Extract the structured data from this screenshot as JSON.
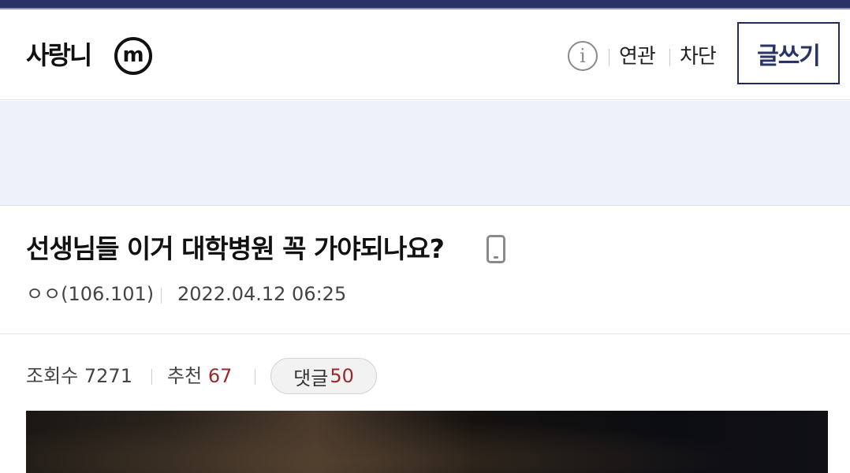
{
  "header": {
    "gallery_name": "사랑니",
    "minor_badge": "m",
    "info_icon": "info-icon",
    "links": [
      "연관",
      "차단"
    ],
    "write_button": "글쓰기"
  },
  "post": {
    "title": "선생님들 이거 대학병원 꼭 가야되나요?",
    "device_icon": "mobile-icon",
    "writer": "ㅇㅇ(106.101)",
    "date": "2022.04.12 06:25"
  },
  "stats": {
    "views_label": "조회수",
    "views_value": "7271",
    "recommend_label": "추천",
    "recommend_value": "67",
    "comments_label": "댓글",
    "comments_value": "50"
  },
  "colors": {
    "top_strip": "#2a3366",
    "write_button_text": "#2a3366",
    "ad_band": "#edf2fa",
    "count_red": "#9a2a2a"
  }
}
